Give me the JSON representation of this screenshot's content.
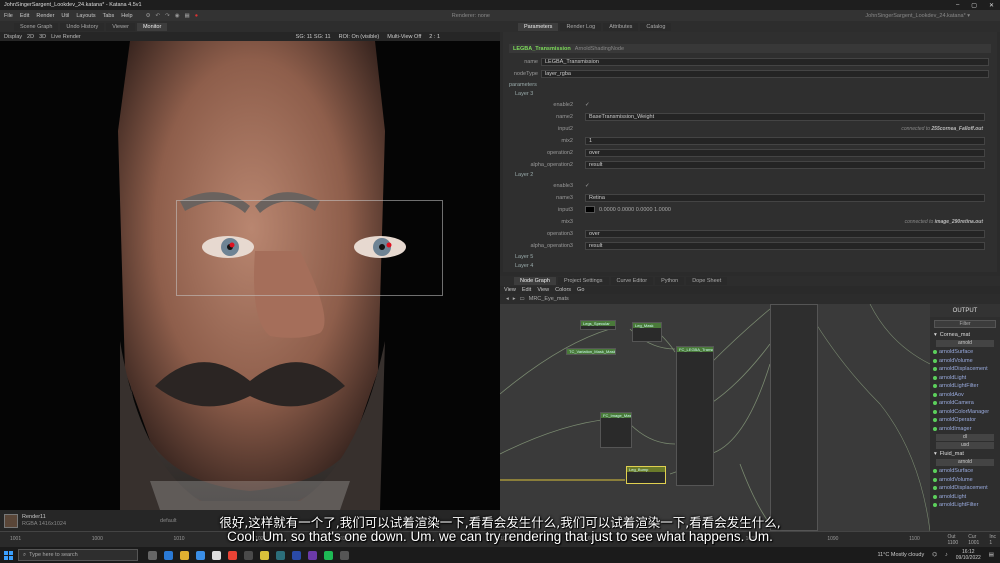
{
  "window": {
    "title": "JohnSingerSargent_Lookdev_24.katana* - Katana 4.5v1",
    "controls": [
      "–",
      "▢",
      "✕"
    ]
  },
  "menu": [
    "File",
    "Edit",
    "Render",
    "Util",
    "Layouts",
    "Tabs",
    "Help"
  ],
  "menu_status": "Renderer: none",
  "right_header": "JohnSingerSargent_Lookdev_24.katana* ▾",
  "left_tabs": [
    "Scene Graph",
    "Undo History",
    "Viewer",
    "Monitor"
  ],
  "monitor_bar": {
    "left": [
      "Display",
      "2D",
      "3D",
      "Live Render"
    ],
    "fields": [
      "ROI: On (visible)",
      "Multi-View Off",
      "2 : 1"
    ],
    "levels": "SG: 11   SG: 11"
  },
  "catalog": {
    "label": "Render11",
    "detail": "RGBA 1416x1024",
    "status": "default"
  },
  "timeline": {
    "ticks": [
      "1001",
      "1000",
      "1010",
      "1020",
      "1030",
      "1040",
      "1050",
      "1060",
      "1070",
      "1080",
      "1090",
      "1100"
    ],
    "right": [
      "Out",
      "Cur",
      "Inc"
    ],
    "right_vals": [
      "1100",
      "1001",
      "1"
    ]
  },
  "param_tabs": [
    "Parameters",
    "Render Log",
    "Attributes",
    "Catalog"
  ],
  "node": {
    "name": "LEGBA_Transmission",
    "type": "ArnoldShadingNode"
  },
  "params": {
    "name_label": "name",
    "name_value": "LEGBA_Transmission",
    "nodetype_label": "nodeType",
    "nodetype_value": "layer_rgba",
    "section": "parameters",
    "layer3": "Layer 3",
    "layer2": "Layer 2",
    "layer5": "Layer 5",
    "layer4": "Layer 4",
    "enable": "enable2",
    "name2": "name2",
    "name2_value": "BaseTransmission_Weight",
    "input2": "input2",
    "connected2": "connected to",
    "connected2_node": "255cornea_Falloff.out",
    "mix2": "mix2",
    "mix2_value": "1",
    "operation2": "operation2",
    "operation2_value": "over",
    "alpha2": "alpha_operation2",
    "alpha2_value": "result",
    "enable3": "enable3",
    "name3": "name3",
    "name3_value": "Retina",
    "input3": "input3",
    "input3_value": "0.0000   0.0000   0.0000   1.0000",
    "mix3": "mix3",
    "connected3": "connected to",
    "connected3_node": "image_290retina.out",
    "operation3": "operation3",
    "operation3_value": "over",
    "alpha3": "alpha_operation3",
    "alpha3_value": "result"
  },
  "node_tabs": [
    "Node Graph",
    "Project Settings",
    "Curve Editor",
    "Python",
    "Dope Sheet"
  ],
  "ng_menu": [
    "View",
    "Edit",
    "View",
    "Colors",
    "Go"
  ],
  "ng_path": "MRC_Eye_mats",
  "graph_nodes": [
    "Legs_Specular",
    "Leg_Mask",
    "TC_Variation_Mask_Mask",
    "FC_LEGBA_Transmission",
    "FC_Image_Mask",
    "Leg_Bump"
  ],
  "output": {
    "title": "OUTPUT",
    "filter": "Filter",
    "mat1": "Cornea_mat",
    "renderer1": "arnold",
    "ports1": [
      "arnoldSurface",
      "arnoldVolume",
      "arnoldDisplacement",
      "arnoldLight",
      "arnoldLightFilter",
      "arnoldAov",
      "arnoldCamera",
      "arnoldColorManager",
      "arnoldOperator",
      "arnoldImager"
    ],
    "sel2": "dl",
    "sel3": "usd",
    "mat2": "Fluid_mat",
    "renderer2": "arnold",
    "ports2": [
      "arnoldSurface",
      "arnoldVolume",
      "arnoldDisplacement",
      "arnoldLight",
      "arnoldLightFilter"
    ]
  },
  "subtitles": {
    "zh": "很好,这样就有一个了,我们可以试着渲染一下,看看会发生什么,我们可以试着渲染一下,看看会发生什么,",
    "en": "Cool. Um. so that's one down. Um. we can try rendering that just to see what happens. Um."
  },
  "taskbar": {
    "search": "Type here to search",
    "weather": "11°C  Mostly cloudy",
    "time": "16:12",
    "date": "09/10/2022"
  }
}
